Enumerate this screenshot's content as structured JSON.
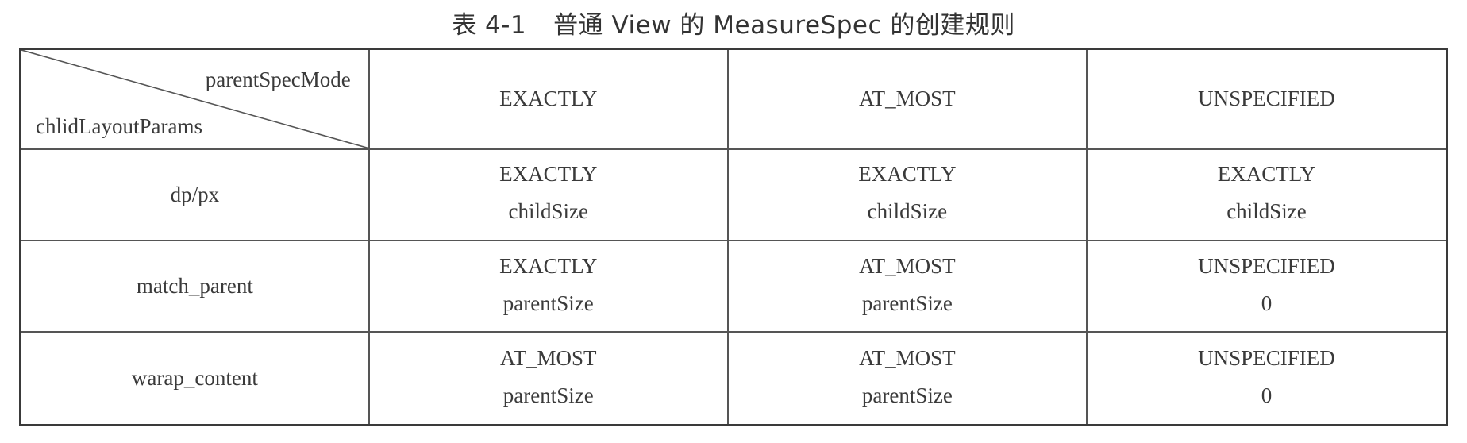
{
  "caption": {
    "number": "表 4-1",
    "title": "普通 View 的 MeasureSpec 的创建规则"
  },
  "table": {
    "corner": {
      "top_label": "parentSpecMode",
      "bottom_label": "chlidLayoutParams"
    },
    "columns": [
      "EXACTLY",
      "AT_MOST",
      "UNSPECIFIED"
    ],
    "rows": [
      {
        "label": "dp/px",
        "cells": [
          {
            "mode": "EXACTLY",
            "size": "childSize"
          },
          {
            "mode": "EXACTLY",
            "size": "childSize"
          },
          {
            "mode": "EXACTLY",
            "size": "childSize"
          }
        ]
      },
      {
        "label": "match_parent",
        "cells": [
          {
            "mode": "EXACTLY",
            "size": "parentSize"
          },
          {
            "mode": "AT_MOST",
            "size": "parentSize"
          },
          {
            "mode": "UNSPECIFIED",
            "size": "0"
          }
        ]
      },
      {
        "label": "warap_content",
        "cells": [
          {
            "mode": "AT_MOST",
            "size": "parentSize"
          },
          {
            "mode": "AT_MOST",
            "size": "parentSize"
          },
          {
            "mode": "UNSPECIFIED",
            "size": "0"
          }
        ]
      }
    ]
  }
}
